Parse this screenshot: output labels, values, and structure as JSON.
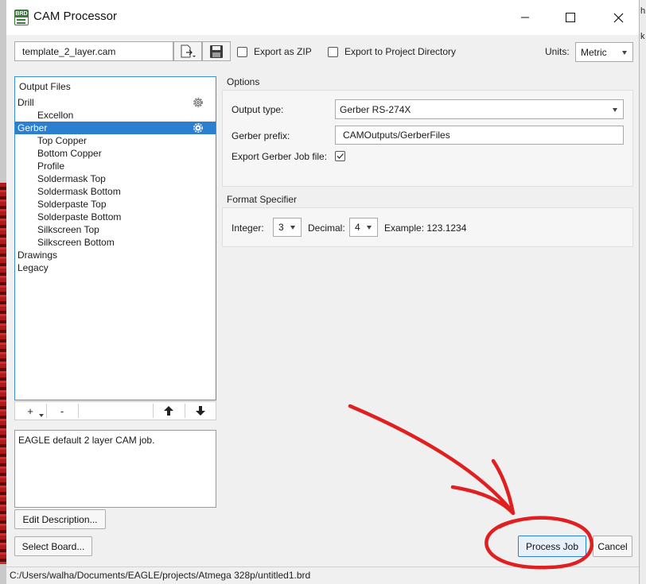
{
  "window": {
    "title": "CAM Processor",
    "icon_text": "BRD"
  },
  "toolbar": {
    "job_file": "template_2_layer.cam",
    "export_zip_label": "Export as ZIP",
    "export_project_dir_label": "Export to Project Directory",
    "units_label": "Units:",
    "units_value": "Metric"
  },
  "tree": {
    "header": "Output Files",
    "items": [
      {
        "label": "Drill",
        "level": 0
      },
      {
        "label": "Excellon",
        "level": 1
      },
      {
        "label": "Gerber",
        "level": 0,
        "selected": true
      },
      {
        "label": "Top Copper",
        "level": 1
      },
      {
        "label": "Bottom Copper",
        "level": 1
      },
      {
        "label": "Profile",
        "level": 1
      },
      {
        "label": "Soldermask Top",
        "level": 1
      },
      {
        "label": "Soldermask Bottom",
        "level": 1
      },
      {
        "label": "Solderpaste Top",
        "level": 1
      },
      {
        "label": "Solderpaste Bottom",
        "level": 1
      },
      {
        "label": "Silkscreen Top",
        "level": 1
      },
      {
        "label": "Silkscreen Bottom",
        "level": 1
      },
      {
        "label": "Drawings",
        "level": 0
      },
      {
        "label": "Legacy",
        "level": 0
      }
    ],
    "add_label": "+",
    "remove_label": "-"
  },
  "description": {
    "text": "EAGLE default 2 layer CAM job.",
    "edit_button": "Edit Description...",
    "select_board_button": "Select Board..."
  },
  "options": {
    "title": "Options",
    "output_type_label": "Output type:",
    "output_type_value": "Gerber RS-274X",
    "gerber_prefix_label": "Gerber prefix:",
    "gerber_prefix_value": "CAMOutputs/GerberFiles",
    "export_job_label": "Export Gerber Job file:",
    "export_job_checked": true
  },
  "format": {
    "title": "Format Specifier",
    "integer_label": "Integer:",
    "integer_value": "3",
    "decimal_label": "Decimal:",
    "decimal_value": "4",
    "example_label": "Example: 123.1234"
  },
  "actions": {
    "process_job": "Process Job",
    "cancel": "Cancel"
  },
  "status": {
    "path": "C:/Users/walha/Documents/EAGLE/projects/Atmega 328p/untitled1.brd"
  },
  "background": {
    "right_edge_text": [
      "h",
      "k"
    ]
  },
  "colors": {
    "selection": "#2b7fd0",
    "focus_border": "#3a8fd6",
    "annotation": "#e02020"
  }
}
